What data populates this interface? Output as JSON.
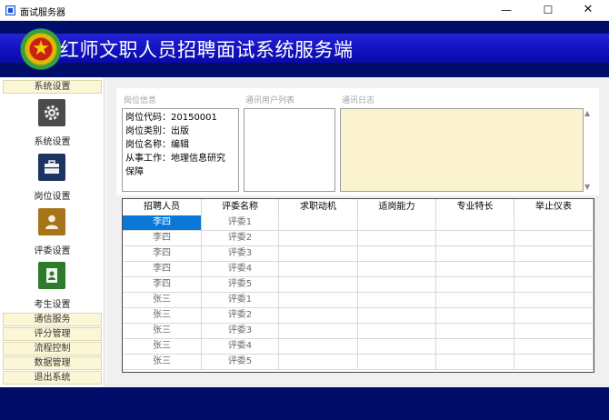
{
  "window": {
    "title": "面试服务器",
    "min_glyph": "—",
    "max_glyph": "☐",
    "close_glyph": "✕"
  },
  "header": {
    "title": "红师文职人员招聘面试系统服务端",
    "emblem_glyph": "★"
  },
  "sidebar": {
    "section_title": "系统设置",
    "tools": [
      {
        "label": "系统设置",
        "icon": "gear-icon"
      },
      {
        "label": "岗位设置",
        "icon": "briefcase-icon"
      },
      {
        "label": "评委设置",
        "icon": "person-icon"
      },
      {
        "label": "考生设置",
        "icon": "contact-card-icon"
      }
    ],
    "links": [
      "通信服务",
      "评分管理",
      "流程控制",
      "数据管理",
      "退出系统"
    ]
  },
  "panel": {
    "info_label": "岗位信息",
    "users_label": "通讯用户列表",
    "log_label": "通讯日志",
    "info_lines": [
      "岗位代码：20150001",
      "岗位类别：出版",
      "岗位名称：编辑",
      "从事工作：地理信息研究",
      "保障"
    ]
  },
  "table": {
    "columns": [
      "招聘人员",
      "评委名称",
      "求职动机",
      "适岗能力",
      "专业特长",
      "举止仪表"
    ],
    "rows": [
      [
        "李四",
        "评委1",
        "",
        "",
        "",
        ""
      ],
      [
        "李四",
        "评委2",
        "",
        "",
        "",
        ""
      ],
      [
        "李四",
        "评委3",
        "",
        "",
        "",
        ""
      ],
      [
        "李四",
        "评委4",
        "",
        "",
        "",
        ""
      ],
      [
        "李四",
        "评委5",
        "",
        "",
        "",
        ""
      ],
      [
        "张三",
        "评委1",
        "",
        "",
        "",
        ""
      ],
      [
        "张三",
        "评委2",
        "",
        "",
        "",
        ""
      ],
      [
        "张三",
        "评委3",
        "",
        "",
        "",
        ""
      ],
      [
        "张三",
        "评委4",
        "",
        "",
        "",
        ""
      ],
      [
        "张三",
        "评委5",
        "",
        "",
        "",
        ""
      ]
    ]
  },
  "colors": {
    "header_bg": "#000e6a",
    "banner": "#1a1ac8",
    "selection": "#0a78d7",
    "log_bg": "#fbf3cf",
    "sidebar_tab": "#fbf6d6"
  }
}
